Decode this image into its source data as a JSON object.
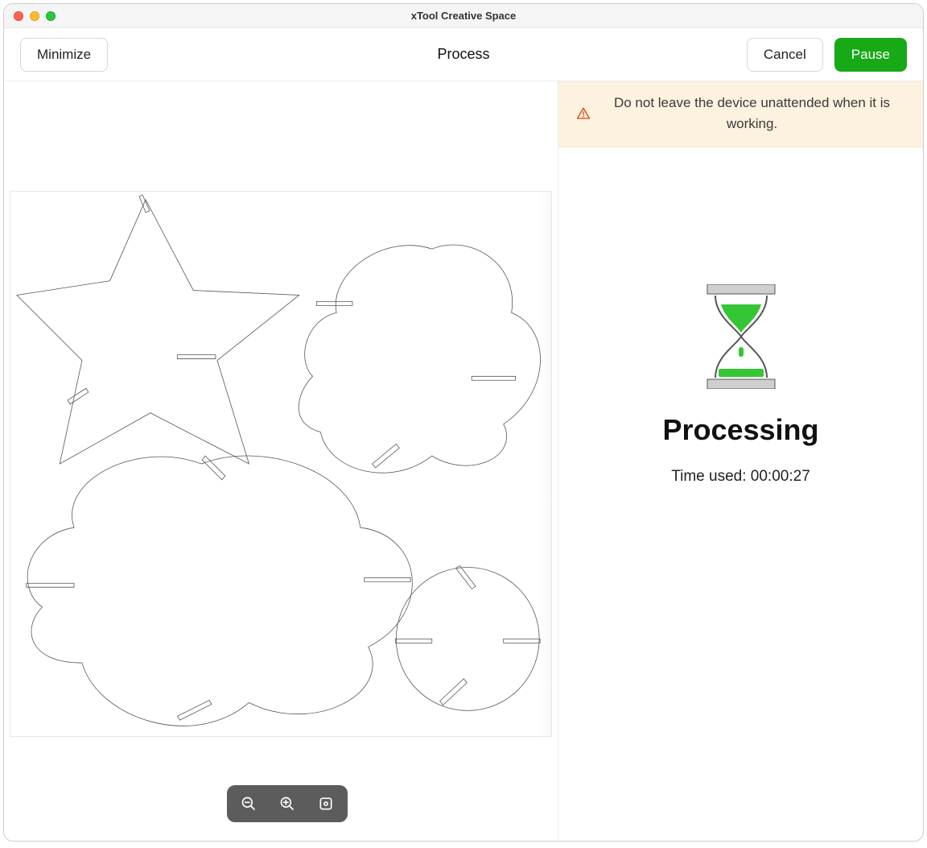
{
  "window": {
    "title": "xTool Creative Space"
  },
  "toolbar": {
    "minimize_label": "Minimize",
    "title": "Process",
    "cancel_label": "Cancel",
    "pause_label": "Pause"
  },
  "warning": {
    "text": "Do not leave the device unattended when it is working."
  },
  "status": {
    "title": "Processing",
    "time_label": "Time used: ",
    "time_value": "00:00:27"
  },
  "zoom": {
    "out_icon": "zoom-out-icon",
    "in_icon": "zoom-in-icon",
    "fit_icon": "zoom-fit-icon"
  },
  "colors": {
    "accent_green": "#17a916",
    "warning_bg": "#fdf1df",
    "warning_icon": "#d9480f"
  }
}
